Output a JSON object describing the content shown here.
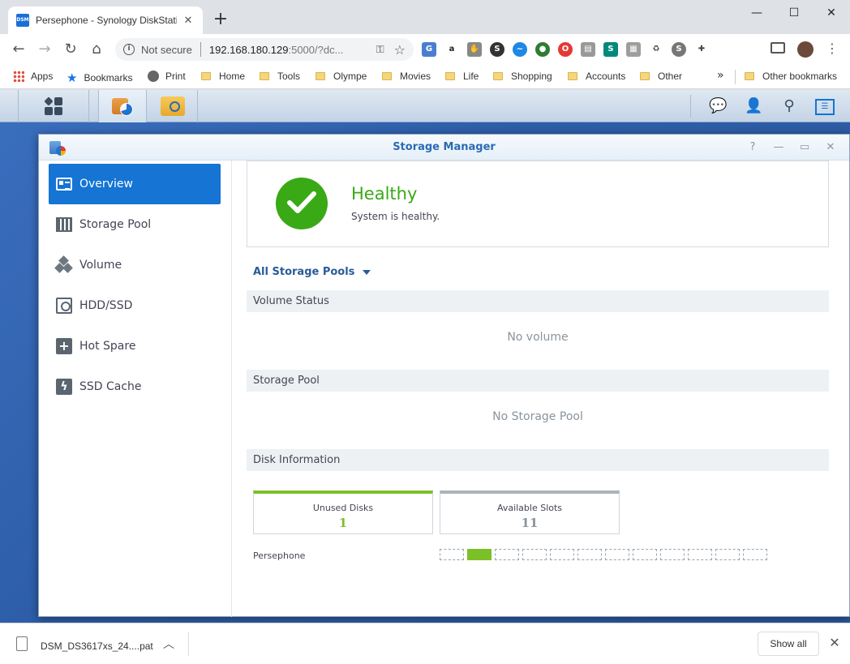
{
  "browser": {
    "tab_title": "Persephone - Synology DiskStatic",
    "tab_favicon": "DSM",
    "security_label": "Not secure",
    "url_host": "192.168.180.129",
    "url_rest": ":5000/?dc...",
    "window_controls": {
      "minimize": "—",
      "maximize": "☐",
      "close": "✕"
    },
    "nav_icons": [
      "back-arrow-icon",
      "forward-arrow-icon",
      "reload-icon",
      "home-icon"
    ]
  },
  "bookmarks": {
    "apps": "Apps",
    "bookmarks": "Bookmarks",
    "print": "Print",
    "folders": [
      "Home",
      "Tools",
      "Olympe",
      "Movies",
      "Life",
      "Shopping",
      "Accounts",
      "Other"
    ],
    "more": "»",
    "other_bookmarks": "Other bookmarks"
  },
  "dsm": {
    "taskbar_icons": [
      "main-menu-icon",
      "storage-manager-icon",
      "file-station-icon"
    ],
    "taskbar_right_icons": [
      "notifications-icon",
      "user-icon",
      "search-icon",
      "widgets-icon"
    ]
  },
  "storage_manager": {
    "title": "Storage Manager",
    "window_controls": {
      "help": "?",
      "minimize": "—",
      "maximize": "▭",
      "close": "✕"
    },
    "nav": [
      {
        "label": "Overview",
        "icon": "overview-icon",
        "active": true
      },
      {
        "label": "Storage Pool",
        "icon": "storage-pool-icon"
      },
      {
        "label": "Volume",
        "icon": "volume-icon"
      },
      {
        "label": "HDD/SSD",
        "icon": "hdd-icon"
      },
      {
        "label": "Hot Spare",
        "icon": "hot-spare-icon"
      },
      {
        "label": "SSD Cache",
        "icon": "ssd-cache-icon"
      }
    ],
    "health": {
      "status": "Healthy",
      "message": "System is healthy.",
      "color": "#39a916"
    },
    "pool_selector": "All Storage Pools",
    "sections": {
      "volume_status": {
        "title": "Volume Status",
        "empty": "No volume"
      },
      "storage_pool": {
        "title": "Storage Pool",
        "empty": "No Storage Pool"
      },
      "disk_info": {
        "title": "Disk Information"
      }
    },
    "disk_cards": [
      {
        "label": "Unused Disks",
        "value": "1",
        "color": "#7cc028"
      },
      {
        "label": "Available Slots",
        "value": "11",
        "color": "#aab3bc"
      }
    ],
    "server_name": "Persephone",
    "slots": {
      "total": 12,
      "filled_index": 1
    }
  },
  "downloads": {
    "file_name": "DSM_DS3617xs_24....pat",
    "show_all": "Show all"
  }
}
